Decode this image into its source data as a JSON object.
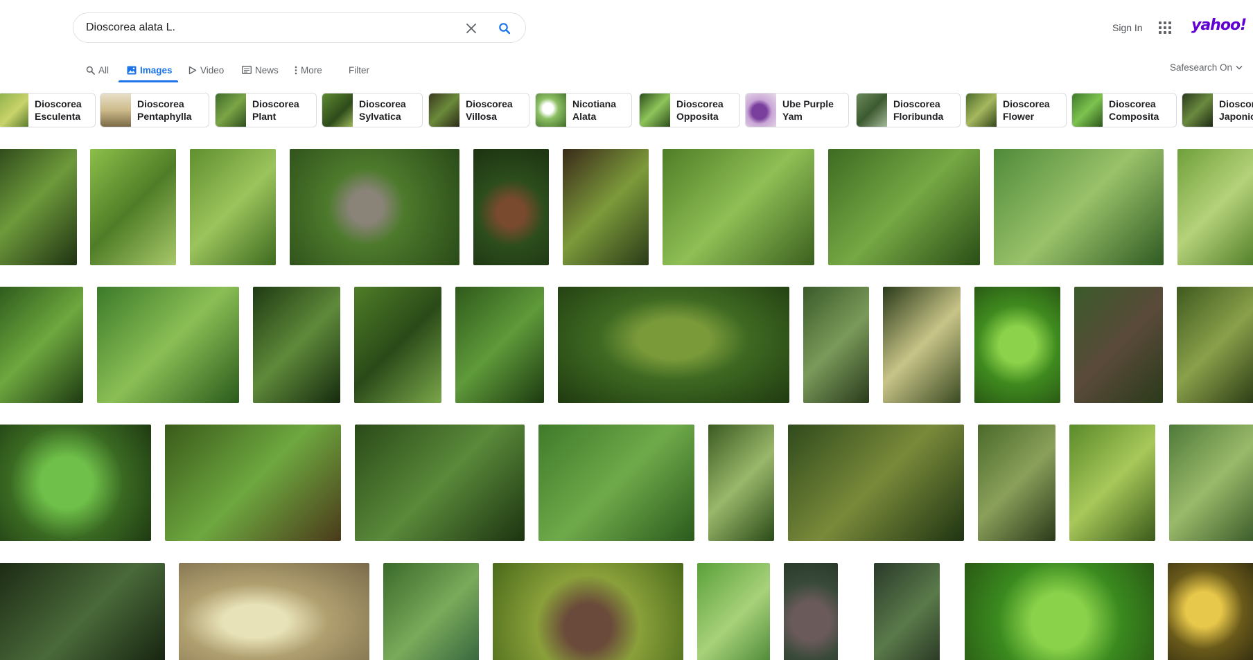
{
  "search": {
    "query": "Dioscorea alata L.",
    "clear_icon": "close-icon",
    "search_icon": "search-icon"
  },
  "header": {
    "sign_in": "Sign In",
    "apps_icon": "apps-grid-icon",
    "logo": "yahoo!",
    "logo_color": "#6001d2"
  },
  "tabs": [
    {
      "label": "All",
      "icon": "search-icon"
    },
    {
      "label": "Images",
      "icon": "image-icon",
      "active": true
    },
    {
      "label": "Video",
      "icon": "play-icon"
    },
    {
      "label": "News",
      "icon": "news-icon"
    },
    {
      "label": "More",
      "icon": "more-vert-icon"
    },
    {
      "label": "Filter"
    }
  ],
  "safesearch": "Safesearch On",
  "accent": "#1a73e8",
  "chips": [
    {
      "label": "Dioscorea\nEsculenta"
    },
    {
      "label": "Dioscorea\nPentaphylla"
    },
    {
      "label": "Dioscorea\nPlant"
    },
    {
      "label": "Dioscorea\nSylvatica"
    },
    {
      "label": "Dioscorea\nVillosa"
    },
    {
      "label": "Nicotiana\nAlata"
    },
    {
      "label": "Dioscorea\nOpposita"
    },
    {
      "label": "Ube Purple\nYam"
    },
    {
      "label": "Dioscorea\nFloribunda"
    },
    {
      "label": "Dioscorea\nFlower"
    },
    {
      "label": "Dioscorea\nComposita"
    },
    {
      "label": "Dioscorea\nJaponica"
    }
  ]
}
